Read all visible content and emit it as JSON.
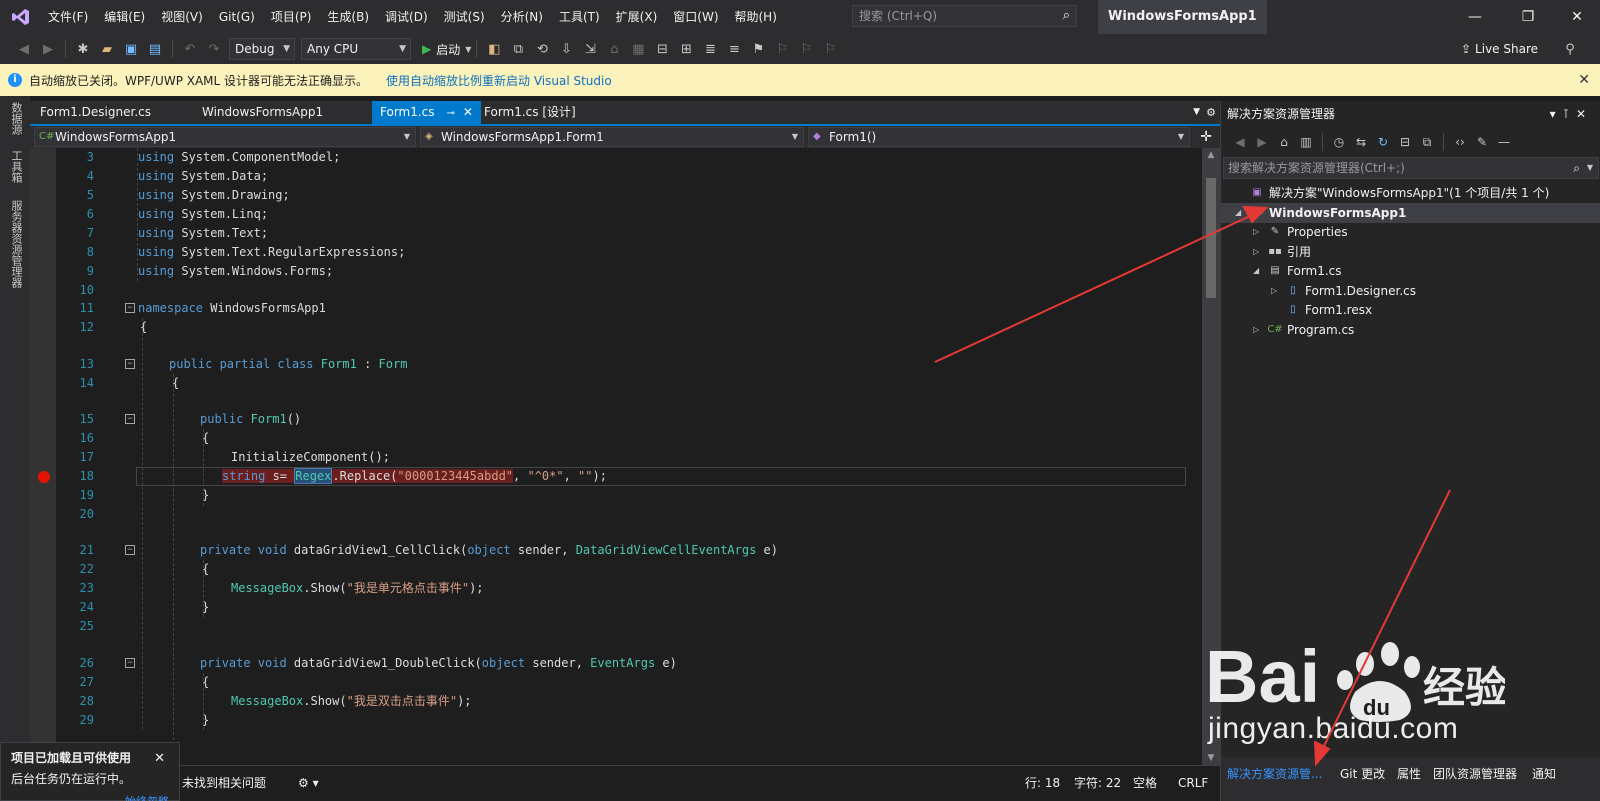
{
  "menubar": {
    "items": [
      "文件(F)",
      "编辑(E)",
      "视图(V)",
      "Git(G)",
      "项目(P)",
      "生成(B)",
      "调试(D)",
      "测试(S)",
      "分析(N)",
      "工具(T)",
      "扩展(X)",
      "窗口(W)",
      "帮助(H)"
    ],
    "search_placeholder": "搜索 (Ctrl+Q)",
    "app_title": "WindowsFormsApp1"
  },
  "toolbar": {
    "config": "Debug",
    "platform": "Any CPU",
    "start_label": "启动",
    "liveshare_label": "Live Share"
  },
  "infobar": {
    "message": "自动缩放已关闭。WPF/UWP XAML 设计器可能无法正确显示。",
    "link": "使用自动缩放比例重新启动 Visual Studio"
  },
  "left_strip": {
    "tabs": [
      "数据源",
      "工具箱",
      "服务器资源管理器"
    ]
  },
  "doc_tabs": [
    {
      "label": "Form1.Designer.cs",
      "active": false
    },
    {
      "label": "WindowsFormsApp1",
      "active": false
    },
    {
      "label": "Form1.cs",
      "active": true
    },
    {
      "label": "Form1.cs [设计]",
      "active": false
    }
  ],
  "navbar": {
    "project": "WindowsFormsApp1",
    "type": "WindowsFormsApp1.Form1",
    "member": "Form1()"
  },
  "code": {
    "lines": [
      {
        "n": "3",
        "tokens": [
          {
            "c": "kw",
            "t": "using "
          },
          {
            "c": "pl",
            "t": "System.ComponentModel;"
          }
        ]
      },
      {
        "n": "4",
        "tokens": [
          {
            "c": "kw",
            "t": "using "
          },
          {
            "c": "pl",
            "t": "System.Data;"
          }
        ]
      },
      {
        "n": "5",
        "tokens": [
          {
            "c": "kw",
            "t": "using "
          },
          {
            "c": "pl",
            "t": "System.Drawing;"
          }
        ]
      },
      {
        "n": "6",
        "tokens": [
          {
            "c": "kw",
            "t": "using "
          },
          {
            "c": "pl",
            "t": "System.Linq;"
          }
        ]
      },
      {
        "n": "7",
        "tokens": [
          {
            "c": "kw",
            "t": "using "
          },
          {
            "c": "pl",
            "t": "System.Text;"
          }
        ]
      },
      {
        "n": "8",
        "tokens": [
          {
            "c": "kw",
            "t": "using "
          },
          {
            "c": "pl",
            "t": "System.Text.RegularExpressions;"
          }
        ]
      },
      {
        "n": "9",
        "tokens": [
          {
            "c": "kw",
            "t": "using "
          },
          {
            "c": "pl",
            "t": "System.Windows.Forms;"
          }
        ]
      },
      {
        "n": "10",
        "tokens": []
      },
      {
        "n": "11",
        "tokens": [
          {
            "c": "kw",
            "t": "namespace "
          },
          {
            "c": "pl",
            "t": "WindowsFormsApp1"
          }
        ]
      },
      {
        "n": "12",
        "tokens": [
          {
            "c": "pl",
            "t": "{"
          }
        ]
      },
      {
        "n": "13",
        "tokens": [
          {
            "c": "kw",
            "t": "public partial class "
          },
          {
            "c": "ty",
            "t": "Form1"
          },
          {
            "c": "pl",
            "t": " : "
          },
          {
            "c": "ty",
            "t": "Form"
          }
        ]
      },
      {
        "n": "14",
        "tokens": [
          {
            "c": "pl",
            "t": "{"
          }
        ]
      },
      {
        "n": "15",
        "tokens": [
          {
            "c": "kw",
            "t": "public "
          },
          {
            "c": "ty",
            "t": "Form1"
          },
          {
            "c": "pl",
            "t": "()"
          }
        ]
      },
      {
        "n": "16",
        "tokens": [
          {
            "c": "pl",
            "t": "{"
          }
        ]
      },
      {
        "n": "17",
        "tokens": [
          {
            "c": "pl",
            "t": "InitializeComponent();"
          }
        ]
      },
      {
        "n": "18",
        "tokens": [
          {
            "c": "kw",
            "t": "string"
          },
          {
            "c": "pl",
            "t": " s= "
          },
          {
            "c": "ty",
            "t": "Regex"
          },
          {
            "c": "pl",
            "t": ".Replace("
          },
          {
            "c": "st",
            "t": "\"0000123445abdd\""
          },
          {
            "c": "pl",
            "t": ", "
          },
          {
            "c": "st",
            "t": "\"^0*\""
          },
          {
            "c": "pl",
            "t": ", "
          },
          {
            "c": "st",
            "t": "\"\""
          },
          {
            "c": "pl",
            "t": ");"
          }
        ]
      },
      {
        "n": "19",
        "tokens": [
          {
            "c": "pl",
            "t": "}"
          }
        ]
      },
      {
        "n": "20",
        "tokens": []
      },
      {
        "n": "21",
        "tokens": [
          {
            "c": "kw",
            "t": "private void "
          },
          {
            "c": "pl",
            "t": "dataGridView1_CellClick("
          },
          {
            "c": "kw",
            "t": "object"
          },
          {
            "c": "pl",
            "t": " sender, "
          },
          {
            "c": "ty",
            "t": "DataGridViewCellEventArgs"
          },
          {
            "c": "pl",
            "t": " e)"
          }
        ]
      },
      {
        "n": "22",
        "tokens": [
          {
            "c": "pl",
            "t": "{"
          }
        ]
      },
      {
        "n": "23",
        "tokens": [
          {
            "c": "ty",
            "t": "MessageBox"
          },
          {
            "c": "pl",
            "t": ".Show("
          },
          {
            "c": "st",
            "t": "\"我是单元格点击事件\""
          },
          {
            "c": "pl",
            "t": ");"
          }
        ]
      },
      {
        "n": "24",
        "tokens": [
          {
            "c": "pl",
            "t": "}"
          }
        ]
      },
      {
        "n": "25",
        "tokens": []
      },
      {
        "n": "26",
        "tokens": [
          {
            "c": "kw",
            "t": "private void "
          },
          {
            "c": "pl",
            "t": "dataGridView1_DoubleClick("
          },
          {
            "c": "kw",
            "t": "object"
          },
          {
            "c": "pl",
            "t": " sender, "
          },
          {
            "c": "ty",
            "t": "EventArgs"
          },
          {
            "c": "pl",
            "t": " e)"
          }
        ]
      },
      {
        "n": "27",
        "tokens": [
          {
            "c": "pl",
            "t": "{"
          }
        ]
      },
      {
        "n": "28",
        "tokens": [
          {
            "c": "ty",
            "t": "MessageBox"
          },
          {
            "c": "pl",
            "t": ".Show("
          },
          {
            "c": "st",
            "t": "\"我是双击点击事件\""
          },
          {
            "c": "pl",
            "t": ");"
          }
        ]
      },
      {
        "n": "29",
        "tokens": [
          {
            "c": "pl",
            "t": "}"
          }
        ]
      }
    ]
  },
  "statusbar": {
    "issues": "未找到相关问题",
    "line": "行: 18",
    "char": "字符: 22",
    "space": "空格",
    "eol": "CRLF"
  },
  "toast": {
    "title": "项目已加载且可供使用",
    "body": "后台任务仍在运行中。",
    "link": "始终忽略"
  },
  "solution_explorer": {
    "title": "解决方案资源管理器",
    "search_placeholder": "搜索解决方案资源管理器(Ctrl+;)",
    "tree": [
      {
        "label": "解决方案\"WindowsFormsApp1\"(1 个项目/共 1 个)",
        "icon": "solution-icon",
        "level": 0,
        "expander": ""
      },
      {
        "label": "WindowsFormsApp1",
        "icon": "csharp-project-icon",
        "level": 0,
        "expander": "open",
        "selected": true,
        "bold": true
      },
      {
        "label": "Properties",
        "icon": "wrench-icon",
        "level": 1,
        "expander": "closed"
      },
      {
        "label": "引用",
        "icon": "references-icon",
        "level": 1,
        "expander": "closed"
      },
      {
        "label": "Form1.cs",
        "icon": "form-icon",
        "level": 1,
        "expander": "open"
      },
      {
        "label": "Form1.Designer.cs",
        "icon": "cs-file-icon",
        "level": 2,
        "expander": "closed"
      },
      {
        "label": "Form1.resx",
        "icon": "resx-icon",
        "level": 2,
        "expander": ""
      },
      {
        "label": "Program.cs",
        "icon": "csharp-file-icon",
        "level": 1,
        "expander": "closed"
      }
    ],
    "bottom_tabs": [
      "解决方案资源管...",
      "Git 更改",
      "属性",
      "团队资源管理器",
      "通知"
    ]
  },
  "watermark": {
    "brand": "Bai 经验",
    "url": "jingyan.baidu.com"
  },
  "colors": {
    "accent": "#007acc",
    "editor_bg": "#1e1e1e",
    "chrome_bg": "#2d2d30",
    "breakpoint": "#e51400",
    "annotation_arrow": "#e53935"
  }
}
